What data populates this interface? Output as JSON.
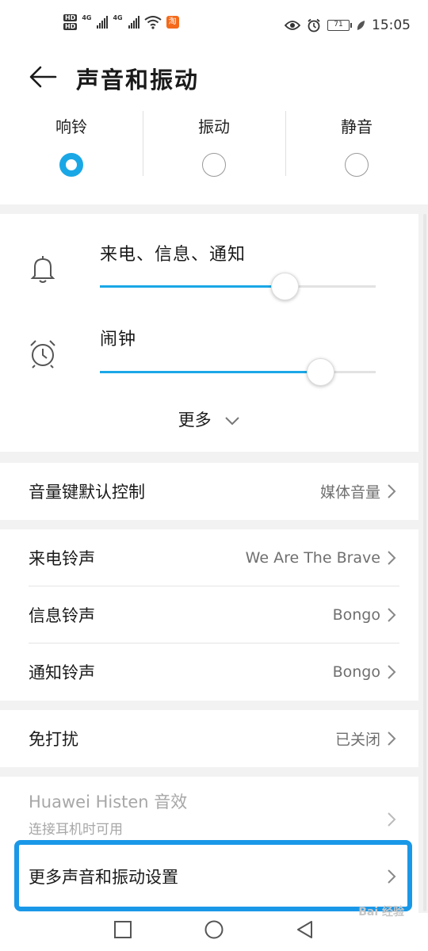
{
  "status_bar": {
    "hd1": "HD",
    "hd2": "HD",
    "net1": "4G",
    "net2": "4G",
    "taobao_badge": "淘",
    "battery": "71",
    "time": "15:05"
  },
  "header": {
    "title": "声音和振动"
  },
  "modes": [
    {
      "label": "响铃",
      "selected": true
    },
    {
      "label": "振动",
      "selected": false
    },
    {
      "label": "静音",
      "selected": false
    }
  ],
  "volume": {
    "ring_label": "来电、信息、通知",
    "ring_level": 0.67,
    "alarm_label": "闹钟",
    "alarm_level": 0.8,
    "more_label": "更多"
  },
  "volume_key": {
    "label": "音量键默认控制",
    "value": "媒体音量"
  },
  "ringtones": {
    "incoming_label": "来电铃声",
    "incoming_value": "We Are The Brave",
    "message_label": "信息铃声",
    "message_value": "Bongo",
    "notification_label": "通知铃声",
    "notification_value": "Bongo"
  },
  "dnd": {
    "label": "免打扰",
    "value": "已关闭"
  },
  "histen": {
    "title": "Huawei Histen 音效",
    "subtitle": "连接耳机时可用"
  },
  "more_settings": {
    "label": "更多声音和振动设置"
  },
  "watermark": "Bai 经验",
  "colors": {
    "accent": "#1aa7e6",
    "highlight": "#1a98e8"
  }
}
